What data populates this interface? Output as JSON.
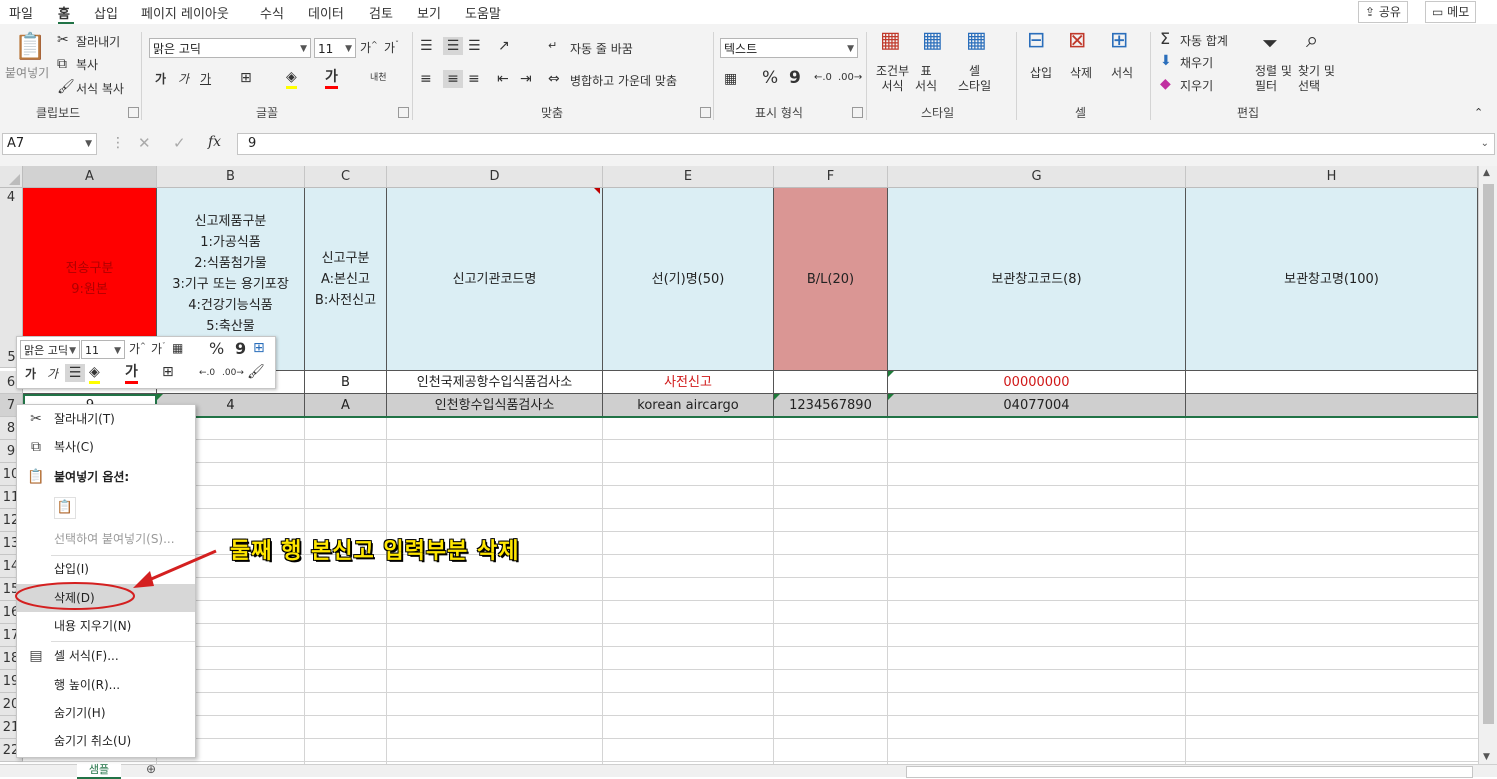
{
  "menu": [
    "파일",
    "홈",
    "삽입",
    "페이지 레이아웃",
    "수식",
    "데이터",
    "검토",
    "보기",
    "도움말"
  ],
  "top_buttons": {
    "share": "공유",
    "memo": "메모"
  },
  "ribbon": {
    "clipboard": {
      "paste": "붙여넣기",
      "cut": "잘라내기",
      "copy": "복사",
      "format_painter": "서식 복사",
      "label": "클립보드"
    },
    "font": {
      "name": "맑은 고딕",
      "size": "11",
      "bold": "가",
      "italic": "가",
      "underline": "가",
      "label": "글꼴"
    },
    "alignment": {
      "wrap": "자동 줄 바꿈",
      "merge": "병합하고 가운데 맞춤",
      "label": "맞춤"
    },
    "number": {
      "format": "텍스트",
      "percent": "%",
      "comma": "9",
      "label": "표시 형식"
    },
    "styles": {
      "conditional": "조건부\n서식",
      "table": "표\n서식",
      "cell": "셀\n스타일",
      "label": "스타일"
    },
    "cells": {
      "insert": "삽입",
      "delete": "삭제",
      "format": "서식",
      "label": "셀"
    },
    "editing": {
      "autosum": "자동 합계",
      "fill": "채우기",
      "clear": "지우기",
      "sort": "정렬 및\n필터",
      "find": "찾기 및\n선택",
      "label": "편집"
    }
  },
  "formula_bar": {
    "name_box": "A7",
    "fx": "fx",
    "value": "9"
  },
  "columns": [
    "A",
    "B",
    "C",
    "D",
    "E",
    "F",
    "G",
    "H"
  ],
  "rows": [
    "4",
    "5",
    "6",
    "7",
    "8",
    "9",
    "10",
    "11",
    "12",
    "13",
    "14",
    "15",
    "16",
    "17",
    "18",
    "19",
    "20",
    "21",
    "22"
  ],
  "header_cells": {
    "A": "전송구분\n9:원본",
    "B": "신고제품구분\n1:가공식품\n2:식품첨가물\n3:기구 또는 용기포장\n4:건강기능식품\n5:축산물",
    "C": "신고구분\nA:본신고\nB:사전신고",
    "D": "신고기관코드명",
    "E": "선(기)명(50)",
    "F": "B/L(20)",
    "G": "보관창고코드(8)",
    "H": "보관창고명(100)"
  },
  "row6": {
    "C": "B",
    "D": "인천국제공항수입식품검사소",
    "E": "사전신고",
    "F": "",
    "G": "00000000",
    "H": ""
  },
  "row7": {
    "A": "9",
    "B": "4",
    "C": "A",
    "D": "인천항수입식품검사소",
    "E": "korean aircargo",
    "F": "1234567890",
    "G": "04077004",
    "H": ""
  },
  "mini_toolbar": {
    "font": "맑은 고딕",
    "size": "11",
    "percent": "%",
    "comma": "9",
    "bold": "가",
    "italic": "가"
  },
  "context_menu": {
    "cut": "잘라내기(T)",
    "copy": "복사(C)",
    "paste_options": "붙여넣기 옵션:",
    "paste_special": "선택하여 붙여넣기(S)...",
    "insert": "삽입(I)",
    "delete": "삭제(D)",
    "clear": "내용 지우기(N)",
    "format_cells": "셀 서식(F)...",
    "row_height": "행 높이(R)...",
    "hide": "숨기기(H)",
    "unhide": "숨기기 취소(U)"
  },
  "annotation": "둘째 행 본신고 입력부분 삭제",
  "sheet_tab": "샘플",
  "colors": {
    "accent": "#217346",
    "red_header": "#ff0000",
    "pink_header": "#da9694",
    "blue_header": "#dbeef4",
    "annotation": "#ffe600",
    "arrow": "#d42020"
  }
}
